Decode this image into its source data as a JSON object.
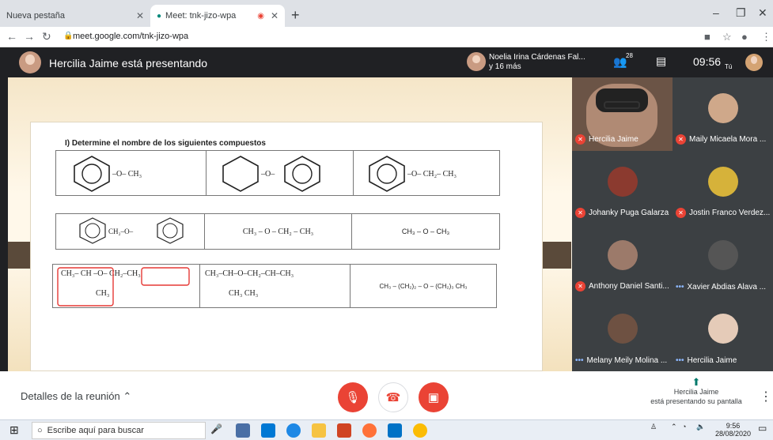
{
  "browser": {
    "tabs": [
      {
        "label": "Nueva pestaña"
      },
      {
        "label": "Meet: tnk-jizo-wpa"
      }
    ],
    "url": "meet.google.com/tnk-jizo-wpa"
  },
  "meet": {
    "presenting_title": "Hercilia Jaime está presentando",
    "presentation_names_line1": "Noelia Irina Cárdenas Fal...",
    "presentation_names_line2": "y 16 más",
    "participant_count": "28",
    "time": "09:56",
    "you_label": "Tú"
  },
  "slide": {
    "question": "I)     Determine el nombre de los siguientes compuestos",
    "row2": [
      "CH₂–O–",
      "CH₃ – O – CH₂ – CH₃",
      "CH₃ – O – CH₃"
    ],
    "row3": [
      "CH₃– CH –O– CH₂–CH₃",
      "CH₃–CH–O–CH₂–CH–CH₃",
      "CH₃ – (CH₂)₂ – O – (CH₂)₃ CH₃"
    ],
    "row3_sub": [
      "CH₃",
      "CH₃         CH₃"
    ],
    "row1_labels": [
      "–O– CH₃",
      "–O–",
      "–O– CH₂– CH₃"
    ]
  },
  "participants": [
    {
      "name": "Hercilia Jaime",
      "status": "muted"
    },
    {
      "name": "Maily Micaela Mora ...",
      "status": "muted"
    },
    {
      "name": "Johanky Puga Galarza",
      "status": "muted"
    },
    {
      "name": "Jostin Franco Verdez...",
      "status": "muted"
    },
    {
      "name": "Anthony Daniel Santi...",
      "status": "muted"
    },
    {
      "name": "Xavier Abdias Alava ...",
      "status": "more"
    },
    {
      "name": "Melany Meily Molina ...",
      "status": "more"
    },
    {
      "name": "Hercilia Jaime",
      "status": "more"
    }
  ],
  "bottom": {
    "details_label": "Detalles de la reunión",
    "presenter_name": "Hercilia Jaime",
    "presenter_status": "está presentando su pantalla"
  },
  "taskbar": {
    "search_placeholder": "Escribe aquí para buscar",
    "time": "9:56",
    "date": "28/08/2020"
  },
  "colors": {
    "mute_red": "#ea4335",
    "meet_dark": "#202124"
  }
}
